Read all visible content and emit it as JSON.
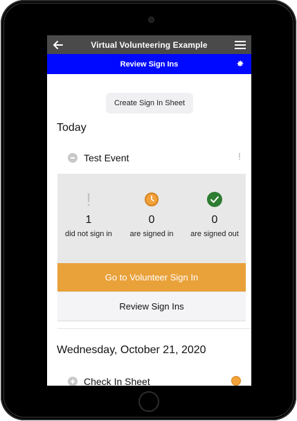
{
  "topbar": {
    "title": "Virtual Volunteering Example",
    "back_icon": "arrow-left-icon",
    "menu_icon": "hamburger-menu-icon"
  },
  "subbar": {
    "title": "Review Sign Ins",
    "settings_icon": "gear-icon"
  },
  "create_button": "Create Sign In Sheet",
  "sections": {
    "today": "Today",
    "date": "Wednesday, October 21, 2020"
  },
  "event": {
    "name": "Test Event",
    "alert": "!"
  },
  "stats": [
    {
      "icon": "exclamation-icon",
      "count": "1",
      "label": "did not sign in"
    },
    {
      "icon": "clock-icon",
      "count": "0",
      "label": "are signed in"
    },
    {
      "icon": "check-circle-icon",
      "count": "0",
      "label": "are signed out"
    }
  ],
  "actions": {
    "go_signin": "Go to Volunteer Sign In",
    "review": "Review Sign Ins"
  },
  "second_event": {
    "name": "Check In Sheet"
  },
  "colors": {
    "topbar": "#4a4a4a",
    "subbar": "#0009ff",
    "accent_orange": "#e9a13a",
    "success_green": "#2e7d32"
  }
}
